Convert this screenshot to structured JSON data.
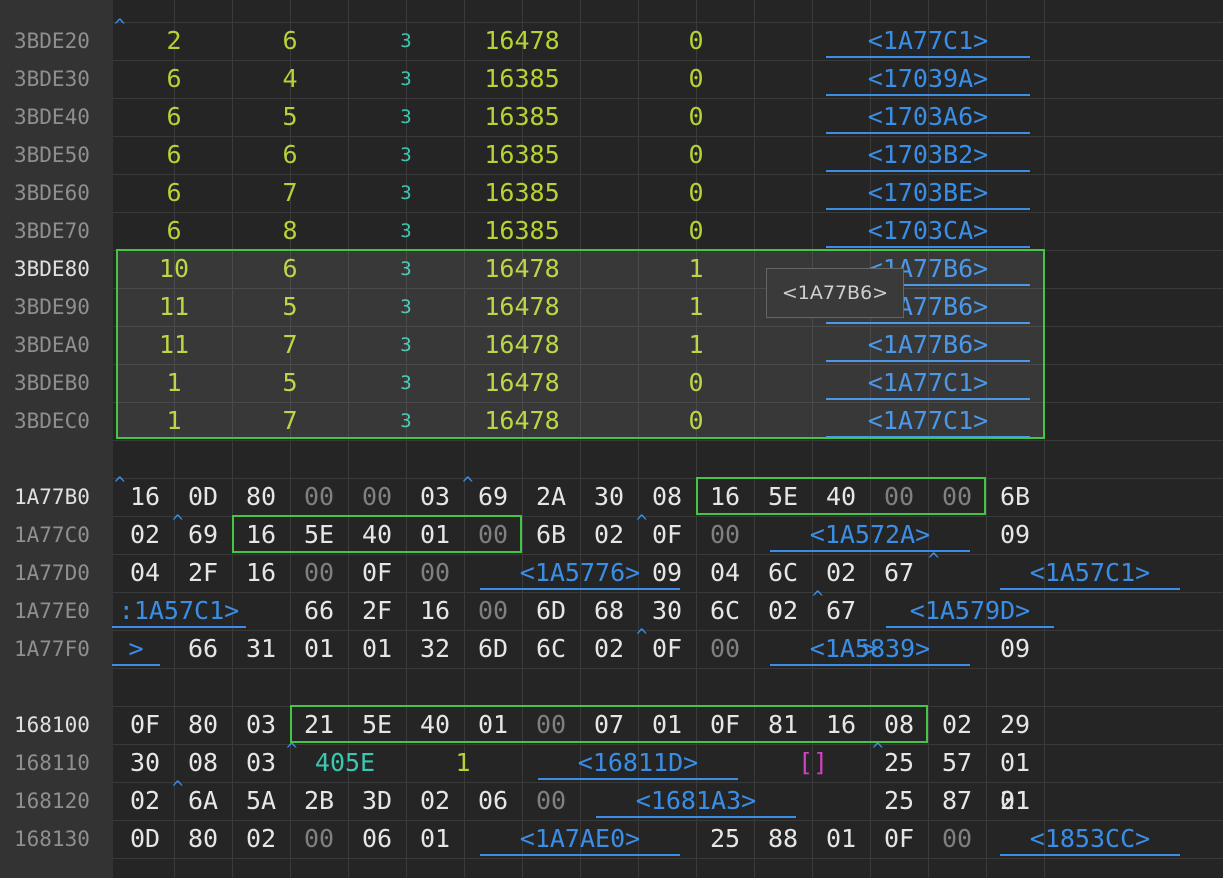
{
  "records": {
    "rows": [
      {
        "addr": "3BDE20",
        "c1": "2",
        "c2": "6",
        "c3": "3",
        "c4": "16478",
        "c5": "0",
        "link": "<1A77C1>",
        "active": false
      },
      {
        "addr": "3BDE30",
        "c1": "6",
        "c2": "4",
        "c3": "3",
        "c4": "16385",
        "c5": "0",
        "link": "<17039A>",
        "active": false
      },
      {
        "addr": "3BDE40",
        "c1": "6",
        "c2": "5",
        "c3": "3",
        "c4": "16385",
        "c5": "0",
        "link": "<1703A6>",
        "active": false
      },
      {
        "addr": "3BDE50",
        "c1": "6",
        "c2": "6",
        "c3": "3",
        "c4": "16385",
        "c5": "0",
        "link": "<1703B2>",
        "active": false
      },
      {
        "addr": "3BDE60",
        "c1": "6",
        "c2": "7",
        "c3": "3",
        "c4": "16385",
        "c5": "0",
        "link": "<1703BE>",
        "active": false
      },
      {
        "addr": "3BDE70",
        "c1": "6",
        "c2": "8",
        "c3": "3",
        "c4": "16385",
        "c5": "0",
        "link": "<1703CA>",
        "active": false
      },
      {
        "addr": "3BDE80",
        "c1": "10",
        "c2": "6",
        "c3": "3",
        "c4": "16478",
        "c5": "1",
        "link": "<1A77B6>",
        "active": true
      },
      {
        "addr": "3BDE90",
        "c1": "11",
        "c2": "5",
        "c3": "3",
        "c4": "16478",
        "c5": "1",
        "link": "<1A77B6>",
        "active": false
      },
      {
        "addr": "3BDEA0",
        "c1": "11",
        "c2": "7",
        "c3": "3",
        "c4": "16478",
        "c5": "1",
        "link": "<1A77B6>",
        "active": false
      },
      {
        "addr": "3BDEB0",
        "c1": "1",
        "c2": "5",
        "c3": "3",
        "c4": "16478",
        "c5": "0",
        "link": "<1A77C1>",
        "active": false
      },
      {
        "addr": "3BDEC0",
        "c1": "1",
        "c2": "7",
        "c3": "3",
        "c4": "16478",
        "c5": "0",
        "link": "<1A77C1>",
        "active": false
      }
    ]
  },
  "tooltip": {
    "text": "<1A77B6>"
  },
  "hex": {
    "rows": [
      {
        "addr": "1A77B0",
        "active": true,
        "bytes": [
          "16",
          "0D",
          "80",
          "00",
          "00",
          "03",
          "69",
          "2A",
          "30",
          "08",
          "16",
          "5E",
          "40",
          "00",
          "00",
          "6B"
        ],
        "links": []
      },
      {
        "addr": "1A77C0",
        "active": false,
        "bytes": [
          "02",
          "69",
          "16",
          "5E",
          "40",
          "01",
          "00",
          "6B",
          "02",
          "0F",
          "00",
          "",
          "",
          "",
          "",
          "09"
        ],
        "links": [
          {
            "text": "<1A572A>"
          }
        ]
      },
      {
        "addr": "1A77D0",
        "active": false,
        "bytes": [
          "04",
          "2F",
          "16",
          "00",
          "0F",
          "00",
          "",
          "",
          "",
          "09",
          "04",
          "6C",
          "02",
          "67",
          "",
          ""
        ],
        "links": [
          {
            "text": "<1A5776>"
          },
          {
            "text": "<1A57C1>"
          }
        ]
      },
      {
        "addr": "1A77E0",
        "active": false,
        "bytes": [
          "",
          "",
          "",
          "66",
          "2F",
          "16",
          "00",
          "6D",
          "68",
          "30",
          "6C",
          "02",
          "67",
          "",
          "",
          ""
        ],
        "links": [
          {
            "text": ":1A57C1>"
          },
          {
            "text": "<1A579D>"
          }
        ]
      },
      {
        "addr": "1A77F0",
        "active": false,
        "bytes": [
          "",
          "66",
          "31",
          "01",
          "01",
          "32",
          "6D",
          "6C",
          "02",
          "0F",
          "00",
          "",
          "",
          "",
          "",
          "09"
        ],
        "links": [
          {
            "text": ">"
          },
          {
            "text": "<1A5839>"
          }
        ]
      },
      {
        "addr": "168100",
        "active": true,
        "bytes": [
          "0F",
          "80",
          "03",
          "21",
          "5E",
          "40",
          "01",
          "00",
          "07",
          "01",
          "0F",
          "81",
          "16",
          "08",
          "02",
          "29"
        ],
        "links": []
      },
      {
        "addr": "168110",
        "active": false,
        "bytes": [
          "30",
          "08",
          "03",
          "",
          "",
          "",
          "",
          "",
          "",
          "",
          "",
          "",
          "",
          "25",
          "57",
          "01"
        ],
        "links": [
          {
            "text": "<16811D>"
          }
        ],
        "fields": {
          "f405e": "405E",
          "f1": "1",
          "bracket": "[]"
        }
      },
      {
        "addr": "168120",
        "active": false,
        "bytes": [
          "02",
          "6A",
          "5A",
          "2B",
          "3D",
          "02",
          "06",
          "00",
          "",
          "",
          "",
          "",
          "",
          "25",
          "87",
          "01"
        ],
        "links": [
          {
            "text": "<1681A3>"
          }
        ],
        "extra": "21"
      },
      {
        "addr": "168130",
        "active": false,
        "bytes": [
          "0D",
          "80",
          "02",
          "00",
          "06",
          "01",
          "",
          "",
          "",
          "",
          "25",
          "88",
          "01",
          "0F",
          "00",
          ""
        ],
        "links": [
          {
            "text": "<1A7AE0>"
          },
          {
            "text": "<1853CC>"
          }
        ]
      }
    ]
  },
  "colors": {
    "accent": "#3a8ee6",
    "value": "#b5d334",
    "type": "#3cc7b0",
    "selection": "#45c545",
    "background": "#252525"
  },
  "icons": {
    "pointer": "caret-up-icon"
  }
}
